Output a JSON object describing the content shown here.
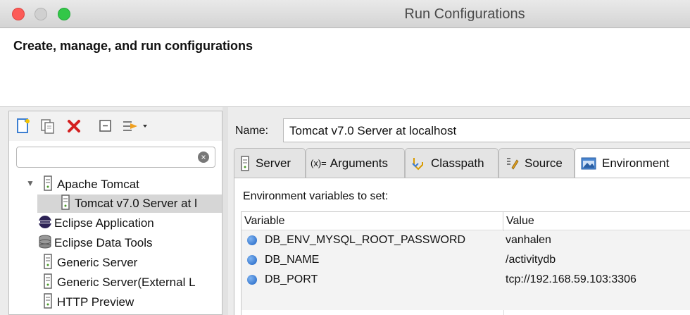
{
  "window": {
    "title": "Run Configurations",
    "header": "Create, manage, and run configurations"
  },
  "left_panel": {
    "toolbar": {
      "icons": [
        "new-config-icon",
        "duplicate-icon",
        "delete-icon",
        "collapse-all-icon",
        "filter-icon"
      ]
    },
    "filter": {
      "value": "",
      "placeholder": ""
    },
    "tree": [
      {
        "label": "Apache Tomcat",
        "icon": "server-icon",
        "expanded": true
      },
      {
        "label": "Tomcat v7.0 Server at l",
        "icon": "server-icon",
        "selected": true
      },
      {
        "label": "Eclipse Application",
        "icon": "eclipse-icon"
      },
      {
        "label": "Eclipse Data Tools",
        "icon": "database-icon"
      },
      {
        "label": "Generic Server",
        "icon": "server-icon"
      },
      {
        "label": "Generic Server(External L",
        "icon": "server-icon"
      },
      {
        "label": "HTTP Preview",
        "icon": "server-icon"
      }
    ]
  },
  "right_panel": {
    "name_label": "Name:",
    "name_value": "Tomcat v7.0 Server at localhost",
    "tabs": [
      {
        "label": "Server",
        "icon": "server-icon"
      },
      {
        "label": "Arguments",
        "icon": "arguments-icon",
        "prefix": "(x)="
      },
      {
        "label": "Classpath",
        "icon": "classpath-icon"
      },
      {
        "label": "Source",
        "icon": "source-icon"
      },
      {
        "label": "Environment",
        "icon": "environment-icon",
        "active": true
      }
    ],
    "env_label": "Environment variables to set:",
    "table": {
      "headers": [
        "Variable",
        "Value"
      ],
      "rows": [
        {
          "variable": "DB_ENV_MYSQL_ROOT_PASSWORD",
          "value": "vanhalen"
        },
        {
          "variable": "DB_NAME",
          "value": "/activitydb"
        },
        {
          "variable": "DB_PORT",
          "value": "tcp://192.168.59.103:3306"
        }
      ]
    }
  }
}
